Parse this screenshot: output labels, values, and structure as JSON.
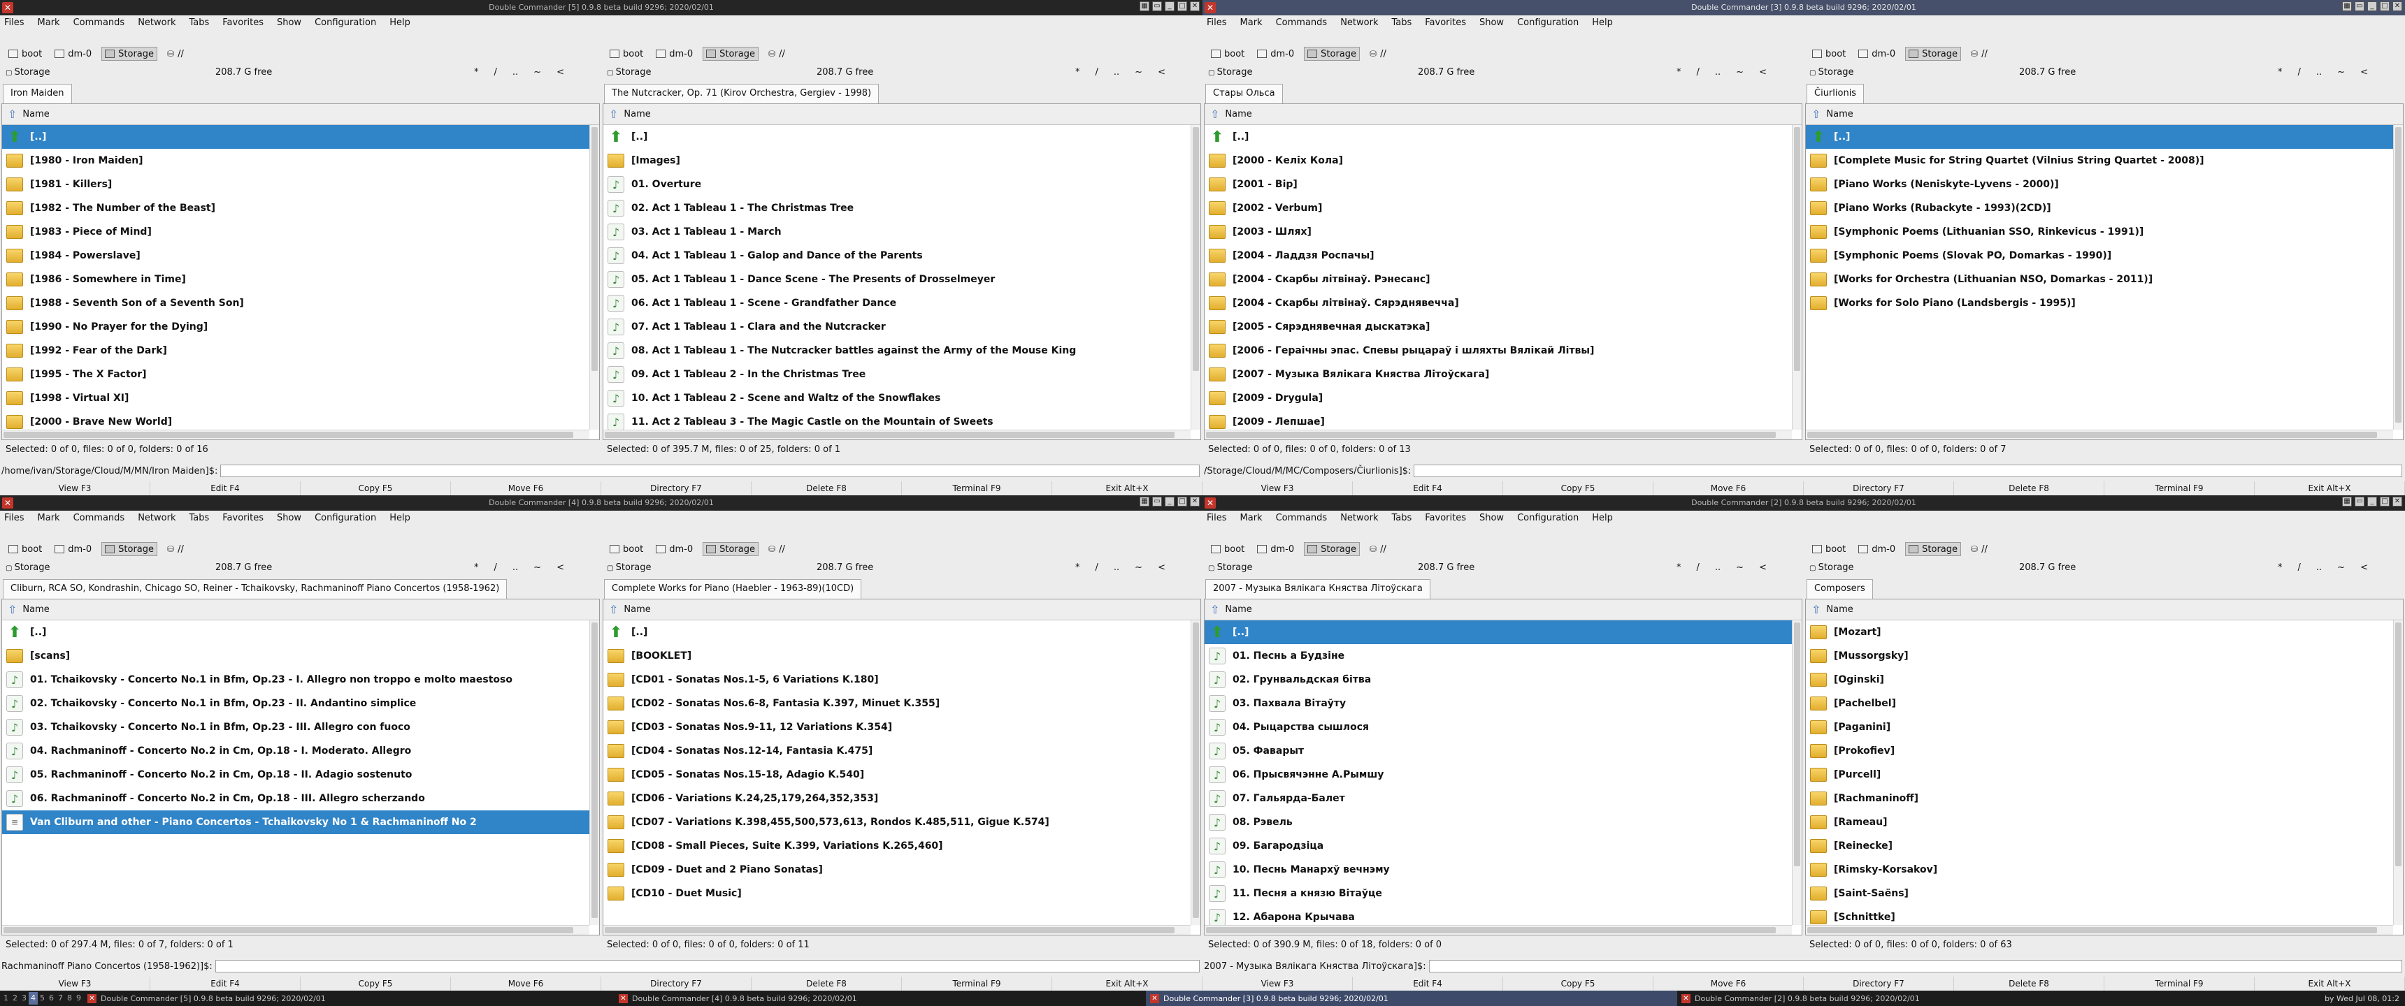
{
  "menu": [
    "Files",
    "Mark",
    "Commands",
    "Network",
    "Tabs",
    "Favorites",
    "Show",
    "Configuration",
    "Help"
  ],
  "drives": {
    "boot": "boot",
    "dm0": "dm-0",
    "storage": "Storage",
    "root": "//"
  },
  "path": {
    "label": "Storage",
    "free": "208.7 G free",
    "nav": [
      "*",
      "/",
      "..",
      "~",
      "<"
    ]
  },
  "fkeys": [
    "View F3",
    "Edit F4",
    "Copy F5",
    "Move F6",
    "Directory F7",
    "Delete F8",
    "Terminal F9",
    "Exit Alt+X"
  ],
  "col_name": "Name",
  "windows": [
    {
      "title": "Double Commander [5] 0.9.8 beta build 9296; 2020/02/01",
      "active": false,
      "cmd_prefix": "/home/ivan/Storage/Cloud/M/MN/Iron Maiden]$:",
      "left": {
        "tab": "Iron Maiden",
        "status": "Selected: 0 of 0, files: 0 of 0, folders: 0 of 16",
        "items": [
          {
            "name": "[..]",
            "type": "up",
            "cursor": true
          },
          {
            "name": "[1980 - Iron Maiden]",
            "type": "folder"
          },
          {
            "name": "[1981 - Killers]",
            "type": "folder"
          },
          {
            "name": "[1982 - The Number of the Beast]",
            "type": "folder"
          },
          {
            "name": "[1983 - Piece of Mind]",
            "type": "folder"
          },
          {
            "name": "[1984 - Powerslave]",
            "type": "folder"
          },
          {
            "name": "[1986 - Somewhere in Time]",
            "type": "folder"
          },
          {
            "name": "[1988 - Seventh Son of a Seventh Son]",
            "type": "folder"
          },
          {
            "name": "[1990 - No Prayer for the Dying]",
            "type": "folder"
          },
          {
            "name": "[1992 - Fear of the Dark]",
            "type": "folder"
          },
          {
            "name": "[1995 - The X Factor]",
            "type": "folder"
          },
          {
            "name": "[1998 - Virtual XI]",
            "type": "folder"
          },
          {
            "name": "[2000 - Brave New World]",
            "type": "folder"
          }
        ]
      },
      "right": {
        "tab": "The Nutcracker, Op. 71 (Kirov Orchestra, Gergiev - 1998)",
        "status": "Selected: 0 of 395.7 M, files: 0 of 25, folders: 0 of 1",
        "items": [
          {
            "name": "[..]",
            "type": "up"
          },
          {
            "name": "[Images]",
            "type": "folder"
          },
          {
            "name": "01. Overture",
            "type": "music"
          },
          {
            "name": "02. Act 1 Tableau 1 - The Christmas Tree",
            "type": "music"
          },
          {
            "name": "03. Act 1 Tableau 1 - March",
            "type": "music"
          },
          {
            "name": "04. Act 1 Tableau 1 - Galop and Dance of the Parents",
            "type": "music"
          },
          {
            "name": "05. Act 1 Tableau 1 - Dance Scene - The Presents of Drosselmeyer",
            "type": "music"
          },
          {
            "name": "06. Act 1 Tableau 1 - Scene - Grandfather Dance",
            "type": "music"
          },
          {
            "name": "07. Act 1 Tableau 1 - Clara and the Nutcracker",
            "type": "music"
          },
          {
            "name": "08. Act 1 Tableau 1 - The Nutcracker battles against the Army of the Mouse King",
            "type": "music"
          },
          {
            "name": "09. Act 1 Tableau 2 - In the Christmas Tree",
            "type": "music"
          },
          {
            "name": "10. Act 1 Tableau 2 - Scene and Waltz of the Snowflakes",
            "type": "music"
          },
          {
            "name": "11. Act 2 Tableau 3 - The Magic Castle on the Mountain of Sweets",
            "type": "music"
          }
        ]
      }
    },
    {
      "title": "Double Commander [3] 0.9.8 beta build 9296; 2020/02/01",
      "active": true,
      "cmd_prefix": "/Storage/Cloud/M/MC/Composers/Čiurlionis]$:",
      "left": {
        "tab": "Стары Ольса",
        "status": "Selected: 0 of 0, files: 0 of 0, folders: 0 of 13",
        "items": [
          {
            "name": "[..]",
            "type": "up"
          },
          {
            "name": "[2000 - Келіх Кола]",
            "type": "folder"
          },
          {
            "name": "[2001 - Вір]",
            "type": "folder"
          },
          {
            "name": "[2002 - Verbum]",
            "type": "folder"
          },
          {
            "name": "[2003 - Шлях]",
            "type": "folder"
          },
          {
            "name": "[2004 - Ладдзя Роспачы]",
            "type": "folder"
          },
          {
            "name": "[2004 - Скарбы літвінаў. Рэнесанс]",
            "type": "folder"
          },
          {
            "name": "[2004 - Скарбы літвінаў. Сярэднявечча]",
            "type": "folder"
          },
          {
            "name": "[2005 - Сярэднявечная дыскатэка]",
            "type": "folder"
          },
          {
            "name": "[2006 - Гераічны эпас. Спевы рыцараў і шляхты Вялікай Літвы]",
            "type": "folder"
          },
          {
            "name": "[2007 - Музыка Вялікага Княства Літоўскага]",
            "type": "folder"
          },
          {
            "name": "[2009 - Drygula]",
            "type": "folder"
          },
          {
            "name": "[2009 - Лепшае]",
            "type": "folder"
          }
        ]
      },
      "right": {
        "tab": "Čiurlionis",
        "status": "Selected: 0 of 0, files: 0 of 0, folders: 0 of 7",
        "items": [
          {
            "name": "[..]",
            "type": "up",
            "cursor": true
          },
          {
            "name": "[Complete Music for String Quartet (Vilnius String Quartet - 2008)]",
            "type": "folder"
          },
          {
            "name": "[Piano Works (Neniskyte-Lyvens - 2000)]",
            "type": "folder"
          },
          {
            "name": "[Piano Works (Rubackyte - 1993)(2CD)]",
            "type": "folder"
          },
          {
            "name": "[Symphonic Poems (Lithuanian SSO, Rinkevicus - 1991)]",
            "type": "folder"
          },
          {
            "name": "[Symphonic Poems (Slovak PO, Domarkas - 1990)]",
            "type": "folder"
          },
          {
            "name": "[Works for Orchestra (Lithuanian NSO, Domarkas - 2011)]",
            "type": "folder"
          },
          {
            "name": "[Works for Solo Piano (Landsbergis - 1995)]",
            "type": "folder"
          }
        ]
      }
    },
    {
      "title": "Double Commander [4] 0.9.8 beta build 9296; 2020/02/01",
      "active": false,
      "cmd_prefix": "Rachmaninoff Piano Concertos (1958-1962)]$:",
      "left": {
        "tab": "Cliburn, RCA SO, Kondrashin, Chicago SO, Reiner - Tchaikovsky, Rachmaninoff Piano Concertos (1958-1962)",
        "status": "Selected: 0 of 297.4 M, files: 0 of 7, folders: 0 of 1",
        "items": [
          {
            "name": "[..]",
            "type": "up"
          },
          {
            "name": "[scans]",
            "type": "folder"
          },
          {
            "name": "01. Tchaikovsky - Concerto No.1 in Bfm, Op.23 - I. Allegro non troppo e molto maestoso",
            "type": "music"
          },
          {
            "name": "02. Tchaikovsky - Concerto No.1 in Bfm, Op.23 - II. Andantino simplice",
            "type": "music"
          },
          {
            "name": "03. Tchaikovsky - Concerto No.1 in Bfm, Op.23 - III. Allegro con fuoco",
            "type": "music"
          },
          {
            "name": "04. Rachmaninoff - Concerto No.2 in Cm, Op.18 - I. Moderato. Allegro",
            "type": "music"
          },
          {
            "name": "05. Rachmaninoff - Concerto No.2 in Cm, Op.18 - II. Adagio sostenuto",
            "type": "music"
          },
          {
            "name": "06. Rachmaninoff - Concerto No.2 in Cm, Op.18 - III. Allegro scherzando",
            "type": "music"
          },
          {
            "name": "Van Cliburn and other - Piano Concertos - Tchaikovsky No 1 & Rachmaninoff No 2",
            "type": "doc",
            "cursor": true
          }
        ]
      },
      "right": {
        "tab": "Complete Works for Piano (Haebler - 1963-89)(10CD)",
        "status": "Selected: 0 of 0, files: 0 of 0, folders: 0 of 11",
        "items": [
          {
            "name": "[..]",
            "type": "up"
          },
          {
            "name": "[BOOKLET]",
            "type": "folder"
          },
          {
            "name": "[CD01 - Sonatas Nos.1-5, 6 Variations K.180]",
            "type": "folder"
          },
          {
            "name": "[CD02 - Sonatas Nos.6-8, Fantasia K.397, Minuet K.355]",
            "type": "folder"
          },
          {
            "name": "[CD03 - Sonatas Nos.9-11, 12 Variations K.354]",
            "type": "folder"
          },
          {
            "name": "[CD04 - Sonatas Nos.12-14, Fantasia K.475]",
            "type": "folder"
          },
          {
            "name": "[CD05 - Sonatas Nos.15-18, Adagio K.540]",
            "type": "folder"
          },
          {
            "name": "[CD06 - Variations K.24,25,179,264,352,353]",
            "type": "folder"
          },
          {
            "name": "[CD07 - Variations K.398,455,500,573,613, Rondos K.485,511, Gigue K.574]",
            "type": "folder"
          },
          {
            "name": "[CD08 - Small Pieces, Suite K.399, Variations K.265,460]",
            "type": "folder"
          },
          {
            "name": "[CD09 - Duet and 2 Piano Sonatas]",
            "type": "folder"
          },
          {
            "name": "[CD10 - Duet Music]",
            "type": "folder"
          }
        ]
      }
    },
    {
      "title": "Double Commander [2] 0.9.8 beta build 9296; 2020/02/01",
      "active": false,
      "cmd_prefix": "2007 - Музыка Вялікага Княства Літоўскага]$:",
      "left": {
        "tab": "2007 - Музыка Вялікага Княства Літоўскага",
        "status": "Selected: 0 of 390.9 M, files: 0 of 18, folders: 0 of 0",
        "items": [
          {
            "name": "[..]",
            "type": "up",
            "cursor": true
          },
          {
            "name": "01. Песнь а Будзіне",
            "type": "music"
          },
          {
            "name": "02. Грунвальдская бітва",
            "type": "music"
          },
          {
            "name": "03. Пахвала Вітаўту",
            "type": "music"
          },
          {
            "name": "04. Рыцарства сышлося",
            "type": "music"
          },
          {
            "name": "05. Фаварыт",
            "type": "music"
          },
          {
            "name": "06. Прысвячэнне А.Рымшу",
            "type": "music"
          },
          {
            "name": "07. Гальярда-Балет",
            "type": "music"
          },
          {
            "name": "08. Рэвель",
            "type": "music"
          },
          {
            "name": "09. Багародзіца",
            "type": "music"
          },
          {
            "name": "10. Песнь Манархў вечнэму",
            "type": "music"
          },
          {
            "name": "11. Песня а князю Вітаўце",
            "type": "music"
          },
          {
            "name": "12. Абарона Крычава",
            "type": "music"
          }
        ]
      },
      "right": {
        "tab": "Composers",
        "status": "Selected: 0 of 0, files: 0 of 0, folders: 0 of 63",
        "items": [
          {
            "name": "[Mozart]",
            "type": "folder"
          },
          {
            "name": "[Mussorgsky]",
            "type": "folder"
          },
          {
            "name": "[Oginski]",
            "type": "folder"
          },
          {
            "name": "[Pachelbel]",
            "type": "folder"
          },
          {
            "name": "[Paganini]",
            "type": "folder"
          },
          {
            "name": "[Prokofiev]",
            "type": "folder"
          },
          {
            "name": "[Purcell]",
            "type": "folder"
          },
          {
            "name": "[Rachmaninoff]",
            "type": "folder"
          },
          {
            "name": "[Rameau]",
            "type": "folder"
          },
          {
            "name": "[Reinecke]",
            "type": "folder"
          },
          {
            "name": "[Rimsky-Korsakov]",
            "type": "folder"
          },
          {
            "name": "[Saint-Saëns]",
            "type": "folder"
          },
          {
            "name": "[Schnittke]",
            "type": "folder"
          }
        ]
      }
    }
  ],
  "taskbar": {
    "workspaces": [
      "1",
      "2",
      "3",
      "4",
      "5",
      "6",
      "7",
      "8",
      "9"
    ],
    "tasks": [
      "Double Commander [5] 0.9.8 beta build 9296; 2020/02/01",
      "Double Commander [4] 0.9.8 beta build 9296; 2020/02/01",
      "Double Commander [3] 0.9.8 beta build 9296; 2020/02/01",
      "Double Commander [2] 0.9.8 beta build 9296; 2020/02/01"
    ],
    "clock": "by Wed Jul 08, 01:2"
  },
  "colors": {
    "cursor": "#3084c8",
    "titlebar": "#252525",
    "titlebar_active": "#46506a"
  }
}
